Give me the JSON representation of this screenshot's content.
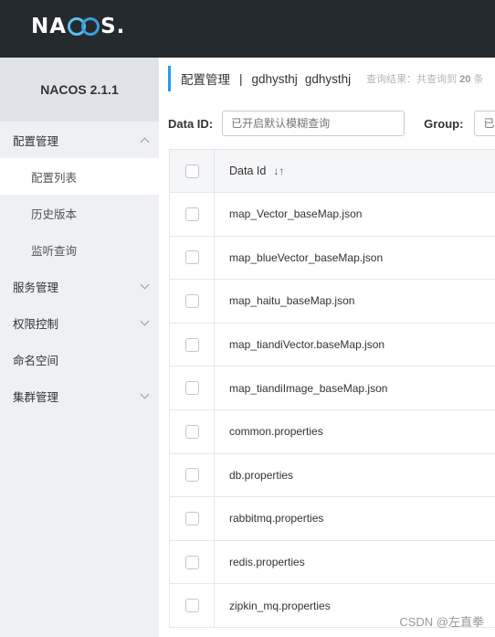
{
  "header": {
    "logo_text_left": "NA",
    "logo_text_right": "S",
    "logo_dot": "."
  },
  "sidebar": {
    "version": "NACOS 2.1.1",
    "items": [
      {
        "label": "配置管理",
        "chevron": "up"
      },
      {
        "label": "配置列表",
        "sub": true,
        "active": true
      },
      {
        "label": "历史版本",
        "sub": true
      },
      {
        "label": "监听查询",
        "sub": true
      },
      {
        "label": "服务管理",
        "chevron": "down"
      },
      {
        "label": "权限控制",
        "chevron": "down"
      },
      {
        "label": "命名空间"
      },
      {
        "label": "集群管理",
        "chevron": "down"
      }
    ]
  },
  "breadcrumb": {
    "title": "配置管理",
    "separator": "|",
    "namespace": "gdhysthj",
    "namespace_id": "gdhysthj",
    "result_prefix": "查询结果：共查询到",
    "result_count": "20",
    "result_suffix": "条"
  },
  "filters": {
    "dataid_label": "Data ID:",
    "dataid_placeholder": "已开启默认模糊查询",
    "group_label": "Group:",
    "group_placeholder": "已"
  },
  "table": {
    "column_dataid": "Data Id",
    "sort_icon": "↓↑",
    "rows": [
      "map_Vector_baseMap.json",
      "map_blueVector_baseMap.json",
      "map_haitu_baseMap.json",
      "map_tiandiVector.baseMap.json",
      "map_tiandiImage_baseMap.json",
      "common.properties",
      "db.properties",
      "rabbitmq.properties",
      "redis.properties",
      "zipkin_mq.properties"
    ]
  },
  "watermark": "CSDN @左直拳"
}
